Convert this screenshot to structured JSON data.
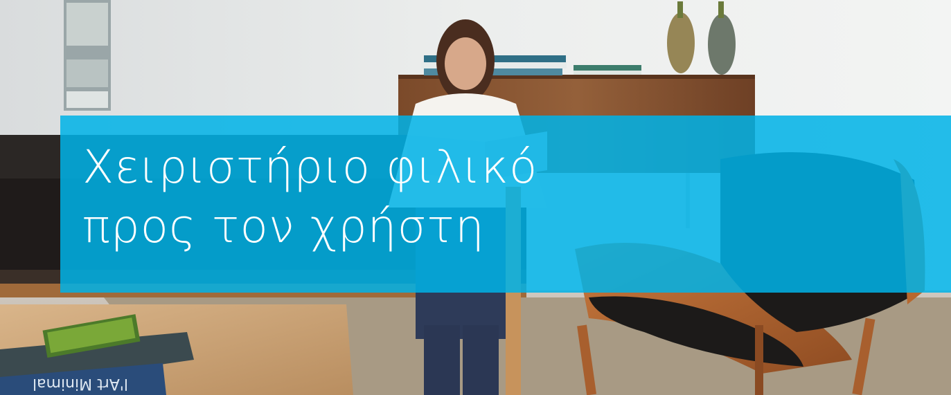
{
  "hero": {
    "image_label": "Woman reading on a sofa in a bright living room with a wooden armchair",
    "headline_line1": "Χειριστήριο φιλικό",
    "headline_line2": "προς τον χρήστη",
    "banner_color": "#00b2e6",
    "book_spine_text": "l'Art Minimal"
  }
}
